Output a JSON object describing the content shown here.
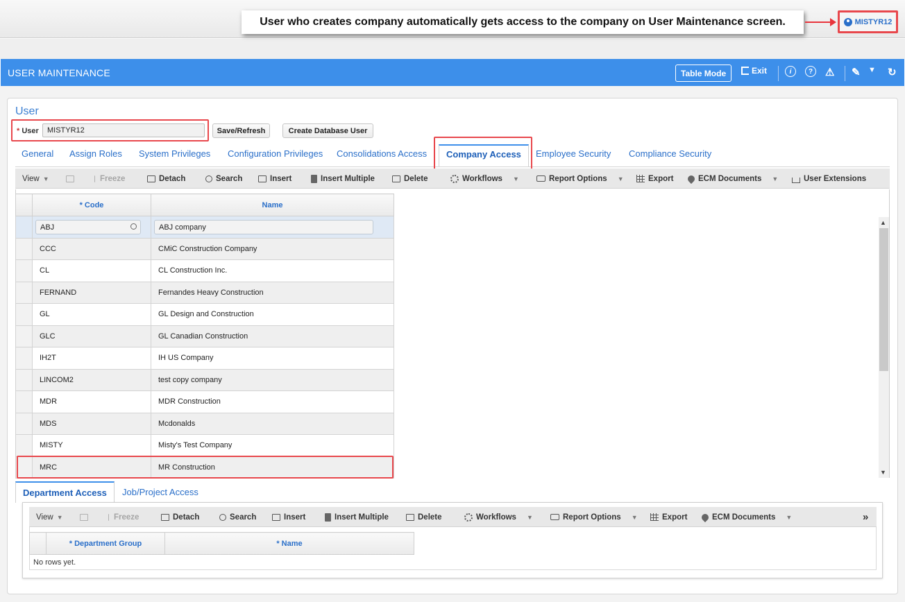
{
  "annotation": {
    "callout_text": "User who creates company automatically gets access to the company on User Maintenance screen.",
    "user_badge": "MISTYR12"
  },
  "header": {
    "title": "USER MAINTENANCE",
    "table_mode": "Table Mode",
    "exit": "Exit",
    "icons": [
      "exit-icon",
      "info-icon",
      "help-icon",
      "warning-icon",
      "edit-icon",
      "chevron-down-icon",
      "refresh-icon"
    ]
  },
  "user_section": {
    "title": "User",
    "user_label": "User",
    "required_mark": "*",
    "user_value": "MISTYR12",
    "save_refresh": "Save/Refresh",
    "create_db_user": "Create Database User"
  },
  "tabs": [
    {
      "label": "General"
    },
    {
      "label": "Assign Roles"
    },
    {
      "label": "System Privileges"
    },
    {
      "label": "Configuration Privileges"
    },
    {
      "label": "Consolidations Access"
    },
    {
      "label": "Company Access",
      "active": true
    },
    {
      "label": "Employee Security"
    },
    {
      "label": "Compliance Security"
    }
  ],
  "toolbar": {
    "view": "View",
    "freeze": "Freeze",
    "detach": "Detach",
    "search": "Search",
    "insert": "Insert",
    "insert_multiple": "Insert Multiple",
    "delete": "Delete",
    "workflows": "Workflows",
    "report_options": "Report Options",
    "export": "Export",
    "ecm_documents": "ECM Documents",
    "user_extensions": "User Extensions",
    "more": "»"
  },
  "company_table": {
    "columns": [
      "Code",
      "Name"
    ],
    "code_required": "*",
    "filter": {
      "code": "ABJ",
      "name": "ABJ company"
    },
    "rows": [
      {
        "code": "CCC",
        "name": "CMiC Construction Company"
      },
      {
        "code": "CL",
        "name": "CL Construction Inc."
      },
      {
        "code": "FERNAND",
        "name": "Fernandes Heavy Construction"
      },
      {
        "code": "GL",
        "name": "GL Design and Construction"
      },
      {
        "code": "GLC",
        "name": "GL Canadian Construction"
      },
      {
        "code": "IH2T",
        "name": "IH US Company"
      },
      {
        "code": "LINCOM2",
        "name": "test copy company"
      },
      {
        "code": "MDR",
        "name": "MDR Construction"
      },
      {
        "code": "MDS",
        "name": "Mcdonalds"
      },
      {
        "code": "MISTY",
        "name": "Misty's Test Company"
      },
      {
        "code": "MRC",
        "name": "MR Construction"
      }
    ]
  },
  "subtabs": [
    {
      "label": "Department Access",
      "active": true
    },
    {
      "label": "Job/Project Access"
    }
  ],
  "dept_table": {
    "columns": [
      "* Department Group",
      "* Name"
    ],
    "empty_text": "No rows yet."
  },
  "colors": {
    "header_blue": "#3d8fea",
    "highlight_red": "#e8474c",
    "link_blue": "#2a6fc9"
  }
}
